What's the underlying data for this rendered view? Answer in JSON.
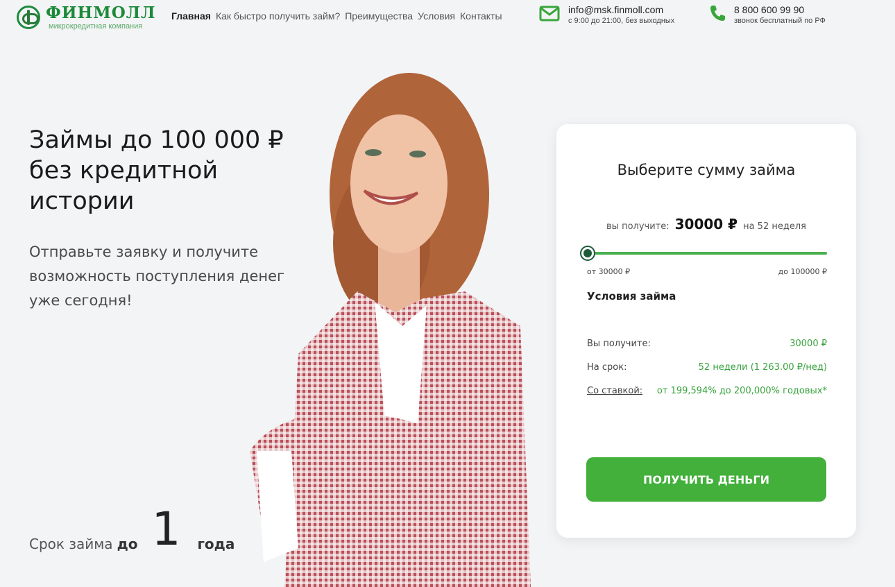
{
  "brand": {
    "name": "ФИНМОЛЛ",
    "tagline": "микрокредитная компания"
  },
  "nav": [
    {
      "label": "Главная",
      "active": true
    },
    {
      "label": "Как быстро получить займ?"
    },
    {
      "label": "Преимущества"
    },
    {
      "label": "Условия"
    },
    {
      "label": "Контакты"
    }
  ],
  "contacts": {
    "email": "info@msk.finmoll.com",
    "email_hours": "с 9:00 до 21:00, без выходных",
    "phone": "8 800 600 99 90",
    "phone_note": "звонок бесплатный по РФ"
  },
  "hero": {
    "title": "Займы до 100 000 ₽ без кредитной истории",
    "subtitle": "Отправьте заявку и получите возможность поступления денег уже сегодня!",
    "term_prefix": "Срок займа",
    "term_do": "до",
    "term_number": "1",
    "term_unit": "года"
  },
  "calculator": {
    "title": "Выберите сумму займа",
    "receive_label": "вы получите:",
    "amount": "30000 ₽",
    "period": "на 52 неделя",
    "slider_level": 0,
    "min_label": "от 30000 ₽",
    "max_label": "до 100000 ₽",
    "conditions_title": "Условия займа",
    "conditions": [
      {
        "key": "Вы получите:",
        "value": "30000 ₽"
      },
      {
        "key": "На срок:",
        "value": "52 недели (1 263.00 ₽/нед)"
      },
      {
        "key": "Со ставкой:",
        "value": "от 199,594% до 200,000% годовых*"
      }
    ],
    "button_label": "ПОЛУЧИТЬ ДЕНЬГИ"
  },
  "colors": {
    "accent": "#42b03a",
    "brand_green": "#1d8a3a",
    "slider_thumb": "#1d5a3a"
  },
  "icons": {
    "email": "envelope-icon",
    "phone": "phone-icon",
    "logo": "finmoll-logo-mark"
  }
}
